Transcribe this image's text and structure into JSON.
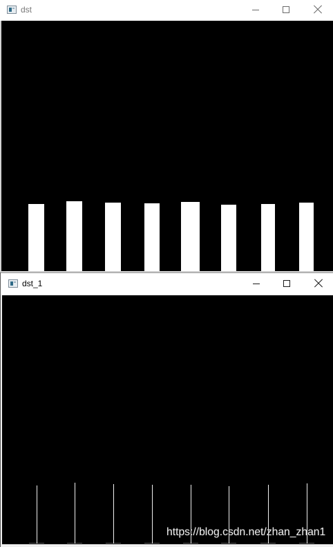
{
  "windows": {
    "dst": {
      "title": "dst",
      "app_icon": "app-window-icon",
      "controls": {
        "minimize": "minimize-icon",
        "maximize": "maximize-icon",
        "close": "close-icon"
      }
    },
    "dst_1": {
      "title": "dst_1",
      "app_icon": "app-window-icon",
      "controls": {
        "minimize": "minimize-icon",
        "maximize": "maximize-icon",
        "close": "close-icon"
      }
    }
  },
  "watermark": "https://blog.csdn.net/zhan_zhan1",
  "colors": {
    "canvas_background": "#000000",
    "drawn_marks": "#ffffff",
    "title_bar": "#ffffff"
  }
}
